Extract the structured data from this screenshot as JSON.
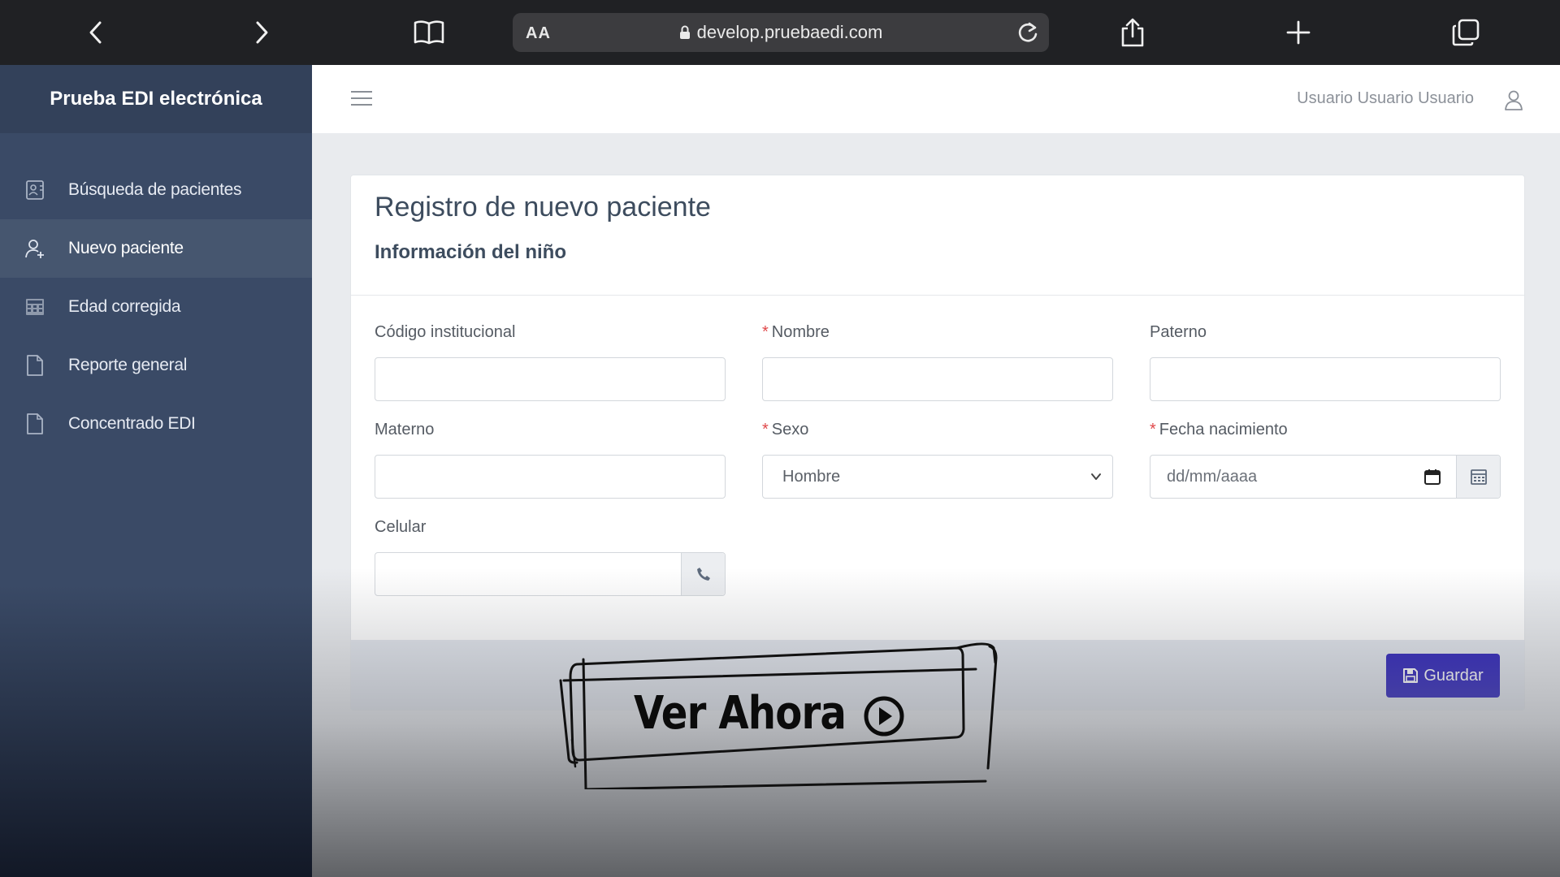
{
  "browser": {
    "text_size_label": "AA",
    "url": "develop.pruebaedi.com"
  },
  "sidebar": {
    "brand": "Prueba EDI electrónica",
    "items": [
      {
        "label": "Búsqueda de pacientes",
        "icon": "address-card-icon"
      },
      {
        "label": "Nuevo paciente",
        "icon": "user-plus-icon",
        "active": true
      },
      {
        "label": "Edad corregida",
        "icon": "calculator-icon"
      },
      {
        "label": "Reporte general",
        "icon": "document-icon"
      },
      {
        "label": "Concentrado EDI",
        "icon": "document-icon"
      }
    ]
  },
  "header": {
    "user_name": "Usuario Usuario Usuario"
  },
  "form": {
    "title": "Registro de nuevo paciente",
    "subtitle": "Información del niño",
    "fields": {
      "codigo": {
        "label": "Código institucional",
        "value": ""
      },
      "nombre": {
        "label": "Nombre",
        "required_mark": "*",
        "value": ""
      },
      "paterno": {
        "label": "Paterno",
        "value": ""
      },
      "materno": {
        "label": "Materno",
        "value": ""
      },
      "sexo": {
        "label": "Sexo",
        "required_mark": "*",
        "selected": "Hombre"
      },
      "fecha": {
        "label": "Fecha nacimiento",
        "required_mark": "*",
        "placeholder": "dd/mm/aaaa"
      },
      "celular": {
        "label": "Celular",
        "value": ""
      }
    },
    "save_label": "Guardar"
  },
  "overlay": {
    "cta_label": "Ver Ahora"
  },
  "colors": {
    "sidebar_bg": "#3a4a66",
    "primary_button": "#2419b8",
    "required_mark": "#e0484a"
  }
}
